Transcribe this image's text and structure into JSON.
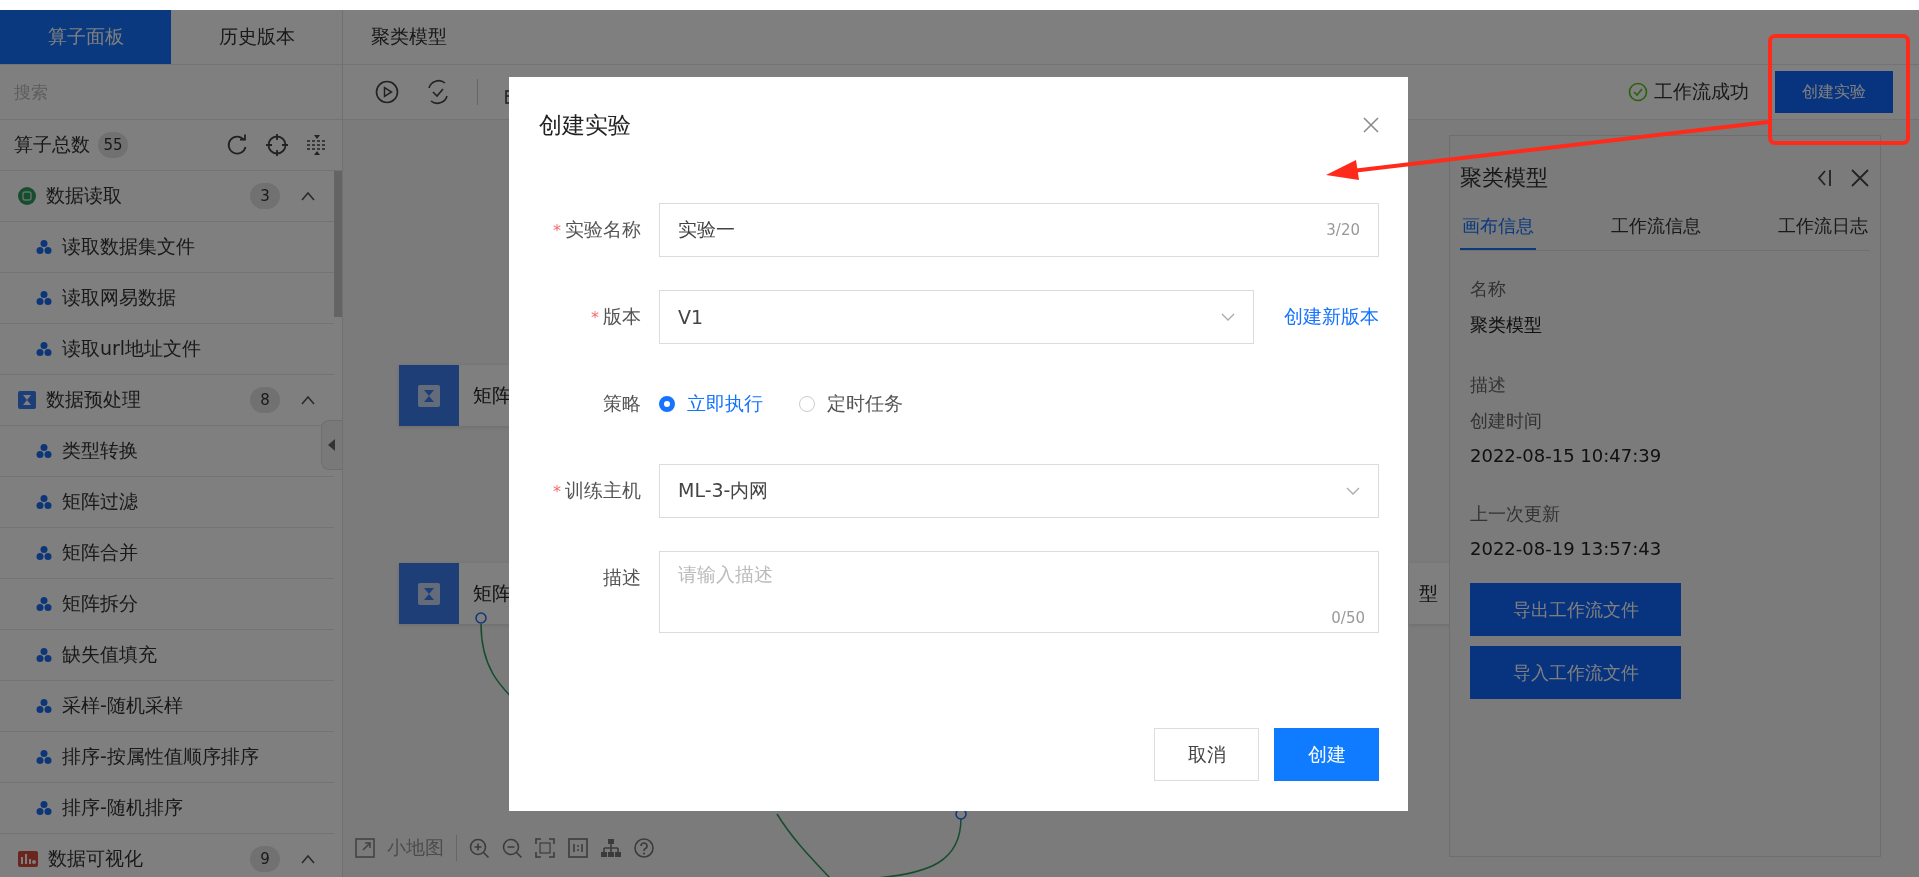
{
  "sidebar": {
    "tabs": [
      {
        "label": "算子面板",
        "selected": true
      },
      {
        "label": "历史版本",
        "selected": false
      }
    ],
    "search": {
      "placeholder": "搜索"
    },
    "total_label": "算子总数",
    "total_count": "55",
    "groups": [
      {
        "kind": "read",
        "label": "数据读取",
        "count": "3",
        "expanded": true,
        "children": [
          {
            "label": "读取数据集文件"
          },
          {
            "label": "读取网易数据"
          },
          {
            "label": "读取url地址文件"
          }
        ]
      },
      {
        "kind": "preprocess",
        "label": "数据预处理",
        "count": "8",
        "expanded": true,
        "children": [
          {
            "label": "类型转换"
          },
          {
            "label": "矩阵过滤"
          },
          {
            "label": "矩阵合并"
          },
          {
            "label": "矩阵拆分"
          },
          {
            "label": "缺失值填充"
          },
          {
            "label": "采样-随机采样"
          },
          {
            "label": "排序-按属性值顺序排序"
          },
          {
            "label": "排序-随机排序"
          }
        ]
      },
      {
        "kind": "visualize",
        "label": "数据可视化",
        "count": "9",
        "expanded": true
      }
    ]
  },
  "canvas_title": "聚类模型",
  "toolbar": {
    "status": "工作流成功",
    "create_button": "创建实验"
  },
  "canvas": {
    "nodes": [
      {
        "label": "矩阵"
      },
      {
        "label": "矩阵"
      },
      {
        "label": "型"
      }
    ],
    "minimap_label": "小地图"
  },
  "info_panel": {
    "title": "聚类模型",
    "tabs": [
      {
        "label": "画布信息",
        "selected": true
      },
      {
        "label": "工作流信息",
        "selected": false
      },
      {
        "label": "工作流日志",
        "selected": false
      }
    ],
    "fields": [
      {
        "label": "名称",
        "value": "聚类模型"
      },
      {
        "label": "描述"
      },
      {
        "label": "创建时间",
        "value": "2022-08-15 10:47:39"
      },
      {
        "label": "上一次更新",
        "value": "2022-08-19 13:57:43"
      }
    ],
    "buttons": [
      "导出工作流文件",
      "导入工作流文件"
    ]
  },
  "dialog": {
    "title": "创建实验",
    "fields": [
      {
        "kind": "text",
        "label": "实验名称",
        "required_mark": "*",
        "value": "实验一",
        "counter": "3/20"
      },
      {
        "kind": "select",
        "label": "版本",
        "required_mark": "*",
        "value": "V1",
        "link": "创建新版本"
      },
      {
        "kind": "radio",
        "label": "策略",
        "options": [
          {
            "label": "立即执行",
            "selected": true
          },
          {
            "label": "定时任务",
            "selected": false
          }
        ]
      },
      {
        "kind": "select",
        "label": "训练主机",
        "required_mark": "*",
        "value": "ML-3-内网"
      },
      {
        "kind": "textarea",
        "label": "描述",
        "placeholder": "请输入描述",
        "counter": "0/50"
      }
    ],
    "buttons": [
      {
        "label": "取消",
        "primary": false
      },
      {
        "label": "创建",
        "primary": true
      }
    ]
  },
  "annotations": {
    "highlight_box": true,
    "arrow": true
  }
}
